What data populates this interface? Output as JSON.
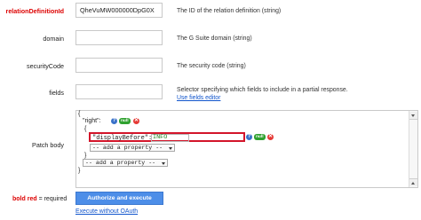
{
  "params": [
    {
      "label": "relationDefinitionId",
      "required": true,
      "value": "QheVuMW000000DpG0X",
      "description": "The ID of the relation definition (string)"
    },
    {
      "label": "domain",
      "required": false,
      "value": "",
      "description": "The G Suite domain (string)"
    },
    {
      "label": "securityCode",
      "required": false,
      "value": "",
      "description": "The security code (string)"
    },
    {
      "label": "fields",
      "required": false,
      "value": "",
      "description": "Selector specifying which fields to include in a partial response.",
      "link": "Use fields editor"
    }
  ],
  "patch_body": {
    "label": "Patch body",
    "line_open": "{",
    "right_key": "\"right\":",
    "right_open": "{",
    "property_key": "\"displayBefore\":",
    "property_value": "INFO",
    "add_property_inner": "-- add a property --",
    "close_inner": "}",
    "add_property_outer": "-- add a property --",
    "close_outer": "}",
    "help_glyph": "?",
    "null_badge": "null",
    "remove_glyph": "✕"
  },
  "footer": {
    "legend_bold": "bold red",
    "legend_rest": " = required",
    "authorize_button": "Authorize and execute",
    "execute_link": "Execute without OAuth"
  },
  "colors": {
    "accent": "#4d8ee8",
    "required": "#dd0000",
    "link": "#1155cc",
    "highlight": "#d3152a"
  }
}
